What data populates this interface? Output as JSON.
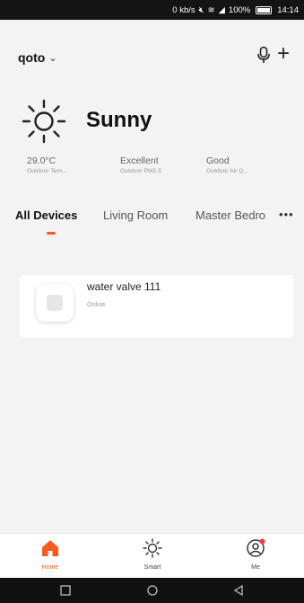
{
  "status_bar": {
    "network_speed": "0 kb/s",
    "battery": "100%",
    "time": "14:14"
  },
  "header": {
    "home_name": "qoto"
  },
  "weather": {
    "condition": "Sunny",
    "metrics": [
      {
        "value": "29.0°C",
        "label": "Outdoor Tem..."
      },
      {
        "value": "Excellent",
        "label": "Outdoor PM2.5"
      },
      {
        "value": "Good",
        "label": "Outdoor Air Q..."
      }
    ]
  },
  "tabs": [
    {
      "label": "All Devices",
      "active": true
    },
    {
      "label": "Living Room",
      "active": false
    },
    {
      "label": "Master Bedro",
      "active": false
    }
  ],
  "devices": [
    {
      "name": "water valve 111",
      "status": "Online"
    }
  ],
  "bottom_nav": [
    {
      "label": "Home",
      "icon": "home-icon",
      "active": true
    },
    {
      "label": "Smart",
      "icon": "smart-sun-icon",
      "active": false
    },
    {
      "label": "Me",
      "icon": "profile-icon",
      "active": false
    }
  ],
  "colors": {
    "accent": "#ff5a22",
    "background": "#f3f3f3"
  }
}
